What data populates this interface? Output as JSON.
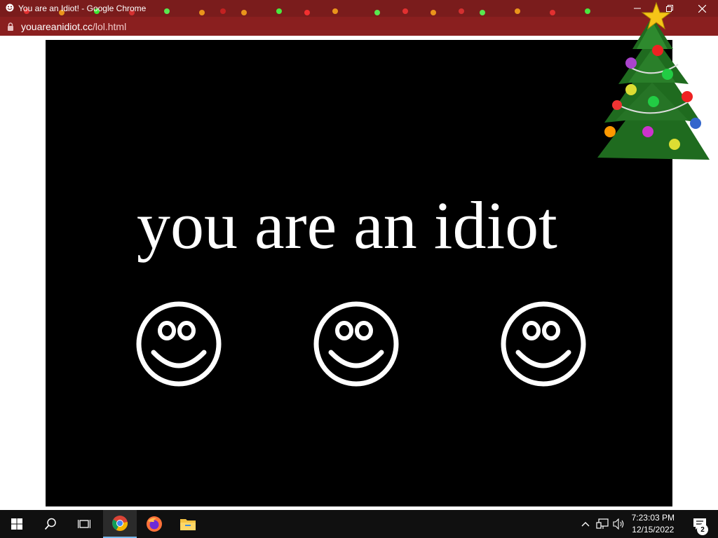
{
  "window": {
    "title": "You are an Idiot! - Google Chrome"
  },
  "address": {
    "host": "youareanidiot.cc",
    "path": "/lol.html"
  },
  "page": {
    "headline": "you are an idiot",
    "smileys": [
      "smiley-face",
      "smiley-face",
      "smiley-face"
    ]
  },
  "icons": {
    "favicon": "smiley-icon",
    "lock": "lock-icon",
    "minimize": "minimize-icon",
    "restore": "restore-icon",
    "close": "close-icon",
    "start": "windows-start-icon",
    "search": "search-icon",
    "taskview": "task-view-icon",
    "chrome": "chrome-icon",
    "firefox": "firefox-icon",
    "explorer": "file-explorer-icon",
    "tray_chevron": "chevron-up-icon",
    "network": "network-icon",
    "volume": "volume-icon",
    "notifications": "notification-icon"
  },
  "taskbar": {
    "time": "7:23:03 PM",
    "date": "12/15/2022",
    "notification_count": "2"
  },
  "colors": {
    "titlebar": "#7a1c1c",
    "addressbar": "#8a1f1f",
    "page_box": "#000000",
    "taskbar": "#101010",
    "accent": "#76b9ed"
  }
}
